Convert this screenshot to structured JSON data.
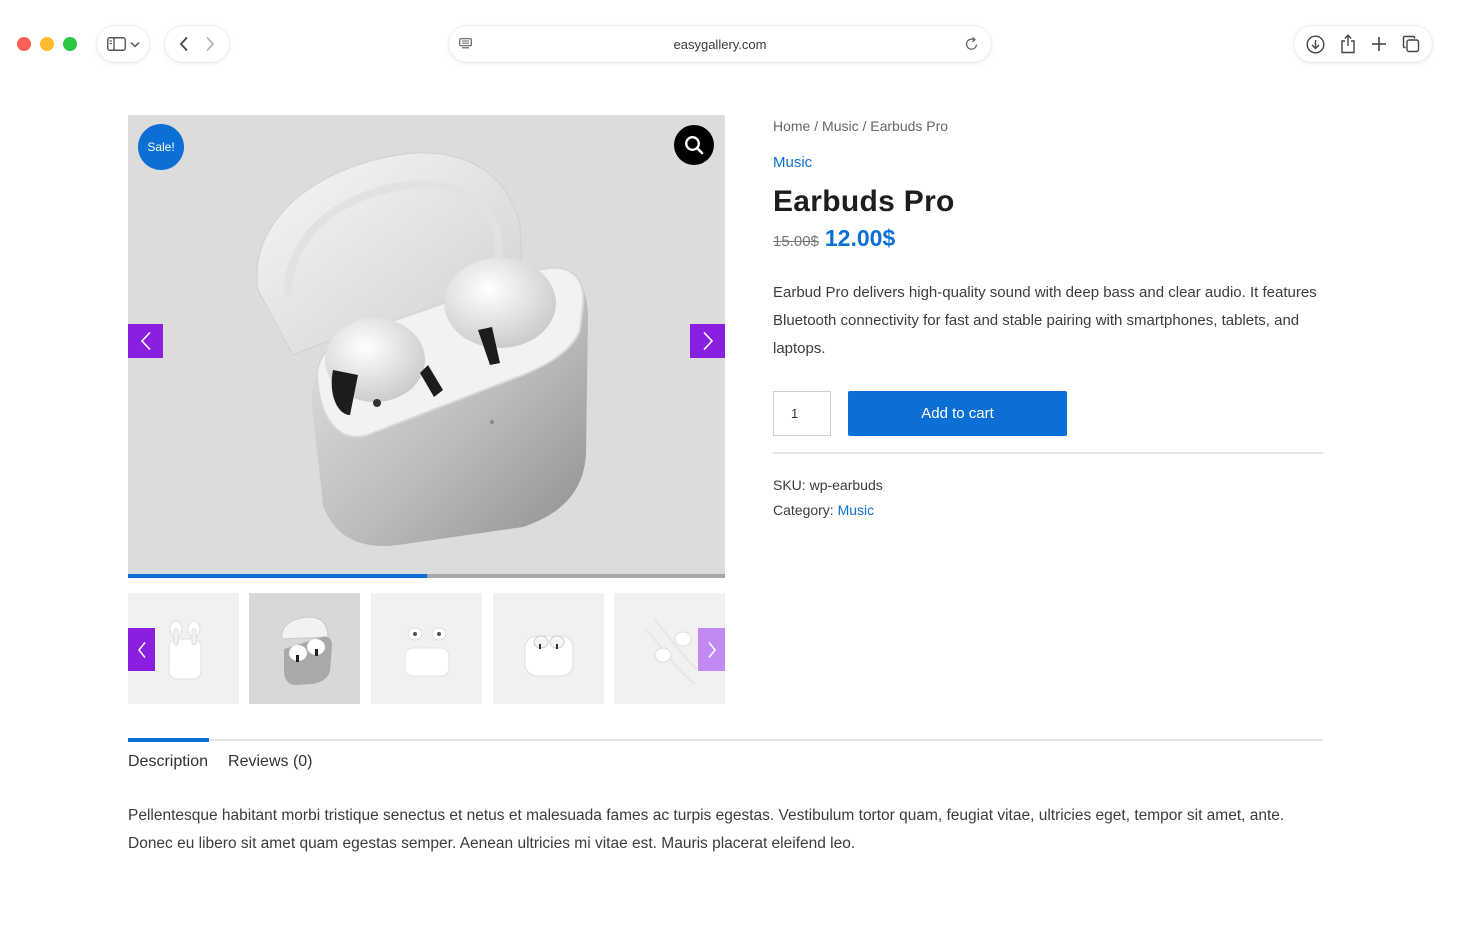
{
  "browser": {
    "url": "easygallery.com"
  },
  "gallery": {
    "sale_badge": "Sale!",
    "progress_fraction": 0.5,
    "thumbnail_count": 5,
    "active_thumbnail": 2
  },
  "product": {
    "breadcrumb": {
      "home": "Home",
      "sep1": " / ",
      "category": "Music",
      "sep2": " / ",
      "current": "Earbuds Pro"
    },
    "category_link": "Music",
    "title": "Earbuds Pro",
    "price_old": "15.00$",
    "price_new": "12.00$",
    "short_description": "Earbud Pro delivers high-quality sound with deep bass and clear audio. It features Bluetooth connectivity for fast and stable pairing with smartphones, tablets, and laptops.",
    "quantity": "1",
    "add_to_cart": "Add to cart",
    "sku_label": "SKU: ",
    "sku_value": "wp-earbuds",
    "category_label": "Category: ",
    "category_value": "Music"
  },
  "tabs": {
    "description": "Description",
    "reviews": "Reviews (0)",
    "description_text": "Pellentesque habitant morbi tristique senectus et netus et malesuada fames ac turpis egestas. Vestibulum tortor quam, feugiat vitae, ultricies eget, tempor sit amet, ante. Donec eu libero sit amet quam egestas semper. Aenean ultricies mi vitae est. Mauris placerat eleifend leo."
  },
  "colors": {
    "accent": "#0b6fd6",
    "arrow": "#8a1fe0",
    "arrow_light": "#c08af2"
  }
}
